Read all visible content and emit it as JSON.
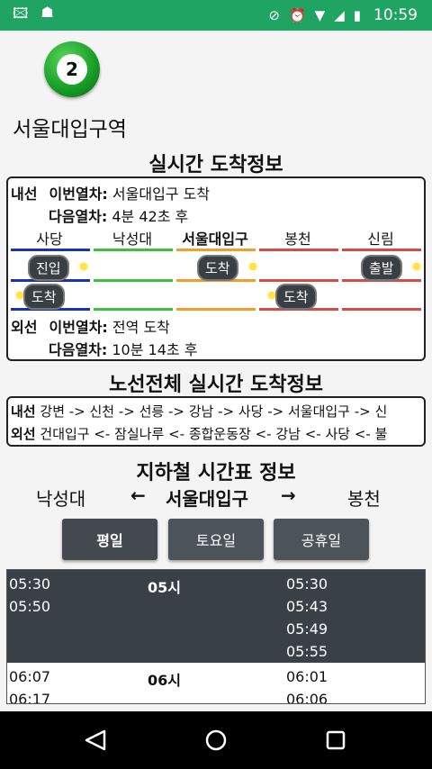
{
  "status_bar": {
    "time": "10:59"
  },
  "line": {
    "number": "2",
    "color": "#1e9e2c"
  },
  "station": {
    "name": "서울대입구역"
  },
  "realtime": {
    "title": "실시간 도착정보",
    "inner": {
      "direction": "내선",
      "this_label": "이번열차:",
      "this_value": "서울대입구 도착",
      "next_label": "다음열차:",
      "next_value": "4분 42초 후"
    },
    "outer": {
      "direction": "외선",
      "this_label": "이번열차:",
      "this_value": "전역 도착",
      "next_label": "다음열차:",
      "next_value": "10분 14초 후"
    },
    "stations": [
      "사당",
      "낙성대",
      "서울대입구",
      "봉천",
      "신림"
    ],
    "station_colors": [
      "#1a33b0",
      "#3fbf3f",
      "#f0a028",
      "#d84a44",
      "#d84a44"
    ],
    "upper_pills": [
      "진입",
      "도착",
      "출발"
    ],
    "lower_pills": [
      "도착",
      "도착"
    ]
  },
  "all_lines": {
    "title": "노선전체 실시간 도착정보",
    "inner_dir": "내선",
    "inner_route": "강변 -> 신천 -> 선릉 -> 강남 -> 사당 -> 서울대입구 -> 신",
    "outer_dir": "외선",
    "outer_route": "건대입구 <- 잠실나루 <- 종합운동장 <- 강남 <- 사당 <- 불"
  },
  "timetable": {
    "title": "지하철 시간표 정보",
    "prev": "낙성대",
    "current": "서울대입구",
    "next": "봉천",
    "left_arrow": "←",
    "right_arrow": "→",
    "buttons": [
      "평일",
      "토요일",
      "공휴일"
    ],
    "hour1": {
      "hour": "05시",
      "left": [
        "05:30",
        "05:50"
      ],
      "right": [
        "05:30",
        "05:43",
        "05:49",
        "05:55"
      ]
    },
    "hour2": {
      "hour": "06시",
      "left": [
        "06:07",
        "06:17"
      ],
      "right": [
        "06:01",
        "06:06"
      ]
    }
  }
}
